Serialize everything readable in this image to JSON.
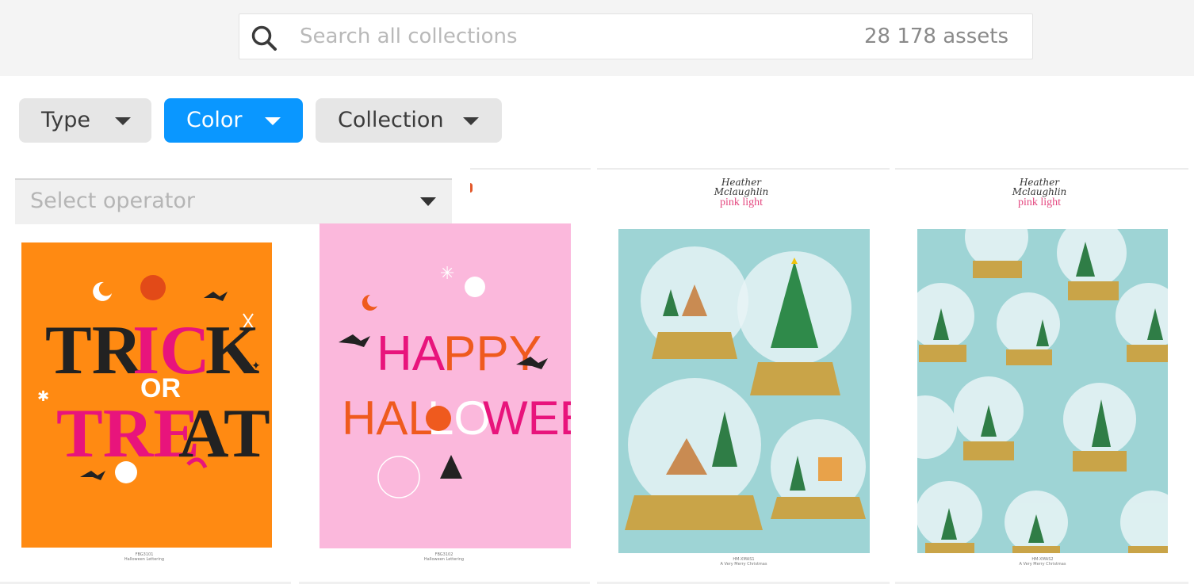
{
  "search": {
    "placeholder": "Search all collections",
    "count": "28 178 assets"
  },
  "filters": [
    {
      "label": "Type",
      "active": false
    },
    {
      "label": "Color",
      "active": true
    },
    {
      "label": "Collection",
      "active": false
    }
  ],
  "operator": {
    "placeholder": "Select operator"
  },
  "colors": {
    "accent": "#0a97ff",
    "orange_art": "#ff8a12",
    "pink_art": "#fbb8dc",
    "aqua_art": "#9ed4d5"
  },
  "assets": [
    {
      "art_text_lines": [
        "TRICK",
        "OR",
        "TREAT"
      ],
      "caption_code": "FBG3101",
      "caption_title": "Halloween Lettering"
    },
    {
      "art_text_lines": [
        "HAPPY",
        "HALLOWEEN"
      ],
      "caption_code": "FBG3102",
      "caption_title": "Halloween Lettering"
    },
    {
      "brand_script": "Heather Mclaughlin",
      "brand_sub": "pink light",
      "caption_code": "HM-XMAS1",
      "caption_title": "A Very Merry Christmas"
    },
    {
      "brand_script": "Heather Mclaughlin",
      "brand_sub": "pink light",
      "caption_code": "HM-XMAS2",
      "caption_title": "A Very Merry Christmas"
    }
  ]
}
